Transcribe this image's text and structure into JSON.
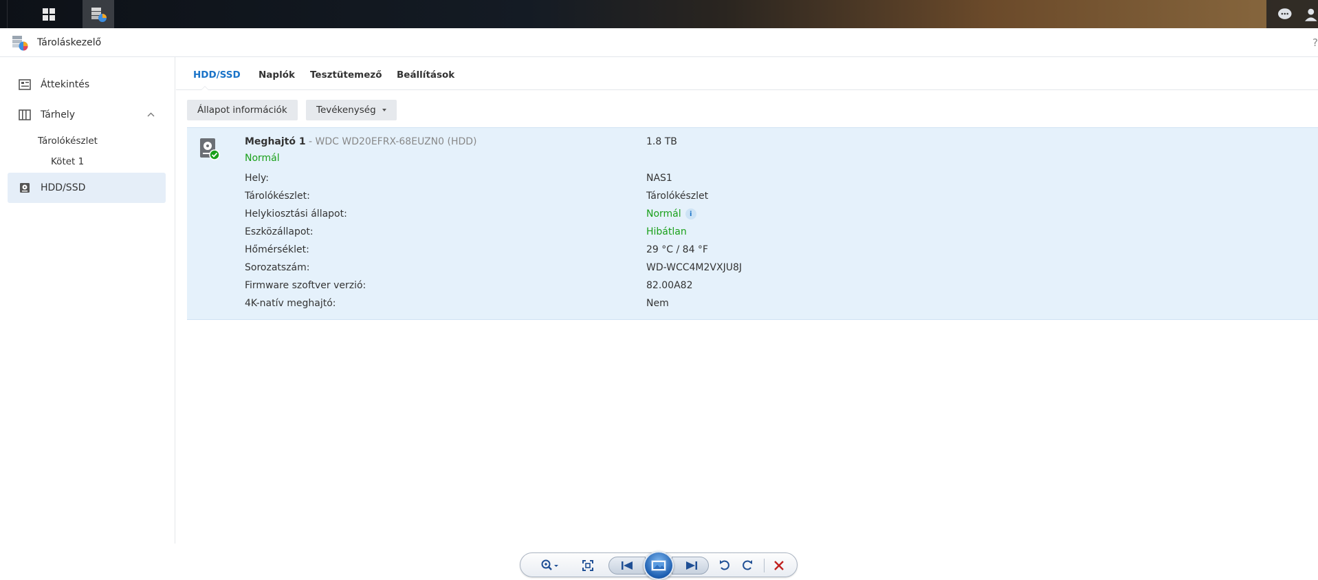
{
  "window": {
    "title": "Tároláskezelő",
    "help": "?"
  },
  "sidebar": {
    "items": [
      {
        "label": "Áttekintés",
        "icon": "overview-icon"
      },
      {
        "label": "Tárhely",
        "icon": "storage-icon",
        "expanded": true
      },
      {
        "label": "Tárolókészlet"
      },
      {
        "label": "Kötet 1"
      },
      {
        "label": "HDD/SSD",
        "icon": "hdd-icon",
        "selected": true
      }
    ]
  },
  "tabs": [
    {
      "label": "HDD/SSD",
      "active": true
    },
    {
      "label": "Naplók"
    },
    {
      "label": "Tesztütemező"
    },
    {
      "label": "Beállítások"
    }
  ],
  "toolbar": {
    "status_button": "Állapot információk",
    "action_button": "Tevékenység"
  },
  "disk": {
    "name": "Meghajtó 1",
    "model": " - WDC WD20EFRX-68EUZN0 (HDD)",
    "size": "1.8 TB",
    "status": "Normál",
    "properties": [
      {
        "label": "Hely:",
        "value": "NAS1"
      },
      {
        "label": "Tárolókészlet:",
        "value": "Tárolókészlet"
      },
      {
        "label": "Helykiosztási állapot:",
        "value": "Normál",
        "status": true,
        "info": true
      },
      {
        "label": "Eszközállapot:",
        "value": "Hibátlan",
        "status": true
      },
      {
        "label": "Hőmérséklet:",
        "value": "29 °C / 84 °F"
      },
      {
        "label": "Sorozatszám:",
        "value": "WD-WCC4M2VXJU8J"
      },
      {
        "label": "Firmware szoftver verzió:",
        "value": "82.00A82"
      },
      {
        "label": "4K-natív meghajtó:",
        "value": "Nem"
      }
    ]
  },
  "colors": {
    "accent": "#1a73c8",
    "status_ok": "#1aa01a",
    "selection": "#e5f1fb"
  }
}
